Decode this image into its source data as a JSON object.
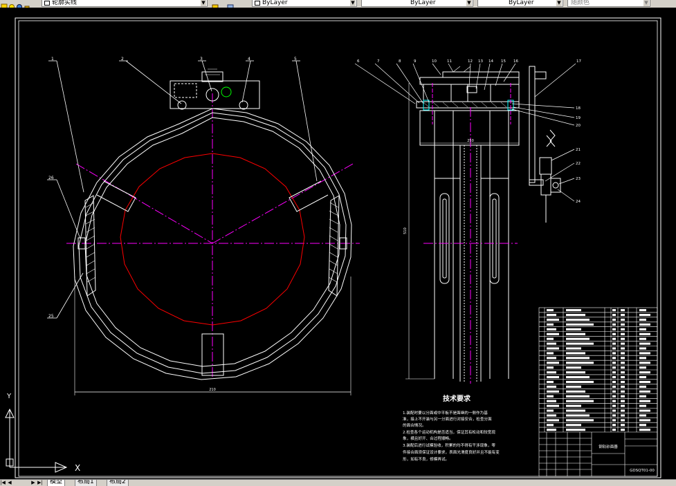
{
  "toolbar": {
    "current_layer": "轮廓实线",
    "color_control": "ByLayer",
    "linetype_control": "ByLayer",
    "lineweight_control": "ByLayer",
    "plot_style": "随颜色"
  },
  "drawing": {
    "front_view": {
      "width_dim": "210",
      "balloons": [
        "1",
        "2",
        "3",
        "4",
        "5",
        "26",
        "25"
      ]
    },
    "side_view": {
      "width_dim": "250",
      "height_dim": "510",
      "balloons_top": [
        "6",
        "7",
        "8",
        "9",
        "10",
        "11",
        "12",
        "13",
        "14",
        "15",
        "16",
        "17"
      ],
      "balloons_right": [
        "18",
        "19",
        "20",
        "21",
        "22",
        "23",
        "24"
      ]
    },
    "tech_requirements": {
      "title": "技术要求",
      "lines": [
        "1.装配时要以分面或中平板不是面继的一侧作为基",
        "准，接上不开装与另一分面进行对接安合，检查分面",
        "的面合情况。",
        "2.检查各个运动机构是否适当，保证其有松动和较宽现",
        "象，横且好开、合过程顺畅。",
        "3.装配后进行试模验收，积累的均不得有干涉现象，零",
        "件接合面须保证设计要求，表面光滑度良好并且不能有变",
        "形，如有不良，修模再试。"
      ]
    },
    "title_block": {
      "drawing_name": "钢轨砂面器",
      "drawing_no": "GDSQT01-00"
    }
  },
  "ucs": {
    "y_label": "Y",
    "x_label": "X"
  },
  "layout_tabs": [
    "模型",
    "布局1",
    "布局2"
  ],
  "colors": {
    "magenta": "#ff00ff",
    "red": "#ff0000",
    "white": "#ffffff",
    "cyan": "#00ffff",
    "green": "#00ff00"
  }
}
